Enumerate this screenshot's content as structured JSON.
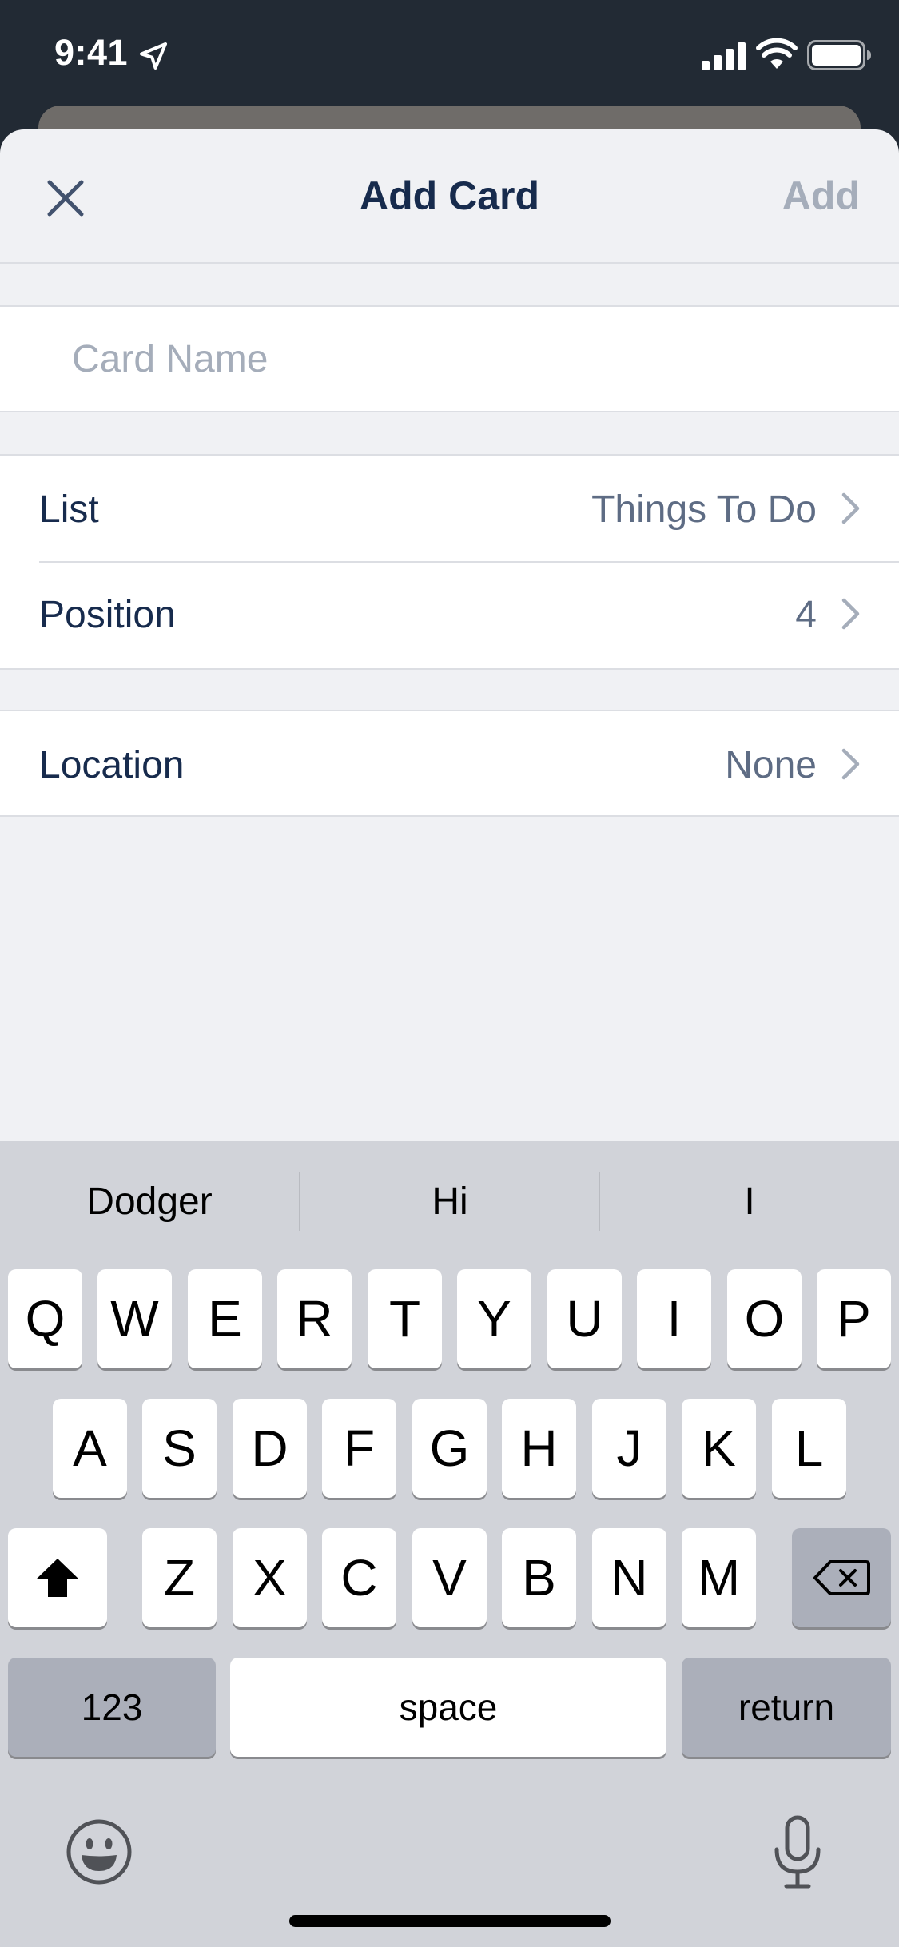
{
  "status_bar": {
    "time": "9:41",
    "icons": [
      "location-arrow-icon",
      "cellular-signal-icon",
      "wifi-icon",
      "battery-icon"
    ]
  },
  "nav": {
    "title": "Add Card",
    "add_label": "Add",
    "close_icon": "close-icon"
  },
  "card_name": {
    "placeholder": "Card Name",
    "value": ""
  },
  "rows": {
    "list": {
      "label": "List",
      "value": "Things To Do"
    },
    "position": {
      "label": "Position",
      "value": "4"
    },
    "location": {
      "label": "Location",
      "value": "None"
    }
  },
  "keyboard": {
    "suggestions": [
      "Dodger",
      "Hi",
      "I"
    ],
    "row1": [
      "Q",
      "W",
      "E",
      "R",
      "T",
      "Y",
      "U",
      "I",
      "O",
      "P"
    ],
    "row2": [
      "A",
      "S",
      "D",
      "F",
      "G",
      "H",
      "J",
      "K",
      "L"
    ],
    "row3": [
      "Z",
      "X",
      "C",
      "V",
      "B",
      "N",
      "M"
    ],
    "numbers_label": "123",
    "space_label": "space",
    "return_label": "return",
    "shift_icon": "shift-icon",
    "delete_icon": "delete-icon",
    "emoji_icon": "emoji-icon",
    "mic_icon": "microphone-icon"
  },
  "colors": {
    "title": "#172b4d",
    "disabled": "#a5adba",
    "value": "#5e6c84",
    "status_bar_bg": "#222a34"
  }
}
